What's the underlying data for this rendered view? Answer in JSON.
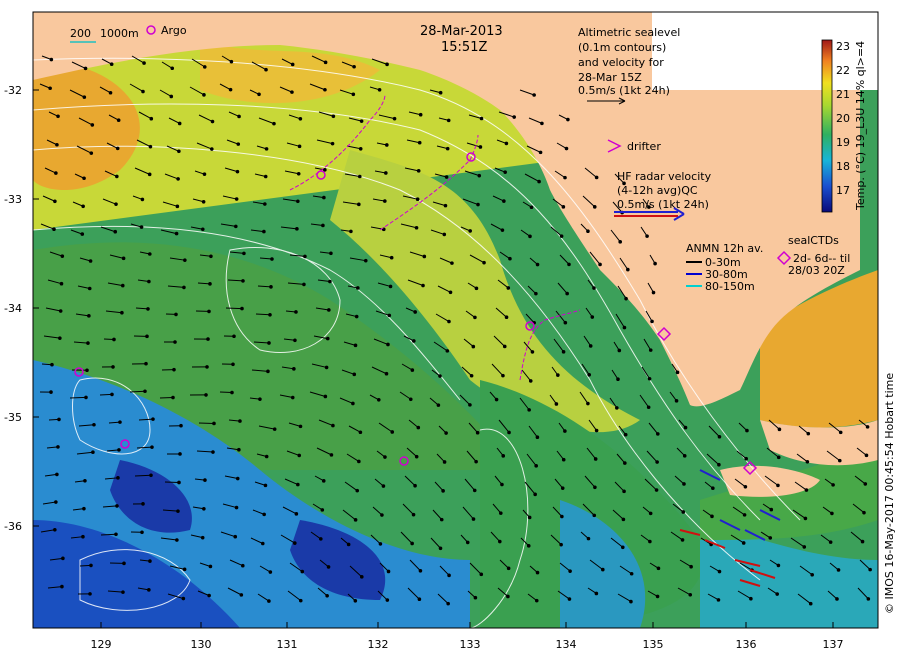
{
  "map": {
    "date": "28-Mar-2013",
    "time": "15:51Z",
    "altimetry_lines": [
      "Altimetric sealevel",
      "(0.1m contours)",
      "and velocity for",
      "28-Mar 15Z",
      "0.5m/s (1kt 24h)"
    ],
    "drifter_label": "drifter",
    "hf_radar_lines": [
      "HF radar velocity",
      "(4-12h avg)QC",
      "0.5m/s (1kt 24h)"
    ],
    "anmn_title": "ANMN 12h av.",
    "anmn_items": [
      {
        "label": "0-30m",
        "color": "#000000"
      },
      {
        "label": "30-80m",
        "color": "#0000d0"
      },
      {
        "label": "80-150m",
        "color": "#00d0d0"
      }
    ],
    "sealctd_lines": [
      "sealCTDs",
      "2d- 6d-- til",
      "28/03 20Z"
    ],
    "depth_legend": {
      "a": "200",
      "b": "1000m"
    },
    "argo_label": "Argo",
    "colorbar_label": "Temp. (°C) 19_L3U 14% ql>=4",
    "credit": "© IMOS 16-May-2017 00:45:54 Hobart time",
    "lon_ticks": [
      "129",
      "130",
      "131",
      "132",
      "133",
      "134",
      "135",
      "136",
      "137"
    ],
    "lat_ticks": [
      "-32",
      "-33",
      "-34",
      "-35",
      "-36"
    ],
    "colorbar_ticks": [
      "23",
      "22",
      "21",
      "20",
      "19",
      "18",
      "17"
    ],
    "colors": {
      "land": "#f9c89e",
      "magenta": "#d000d0",
      "hf_red": "#d01010",
      "hf_blue": "#2020d0"
    }
  }
}
